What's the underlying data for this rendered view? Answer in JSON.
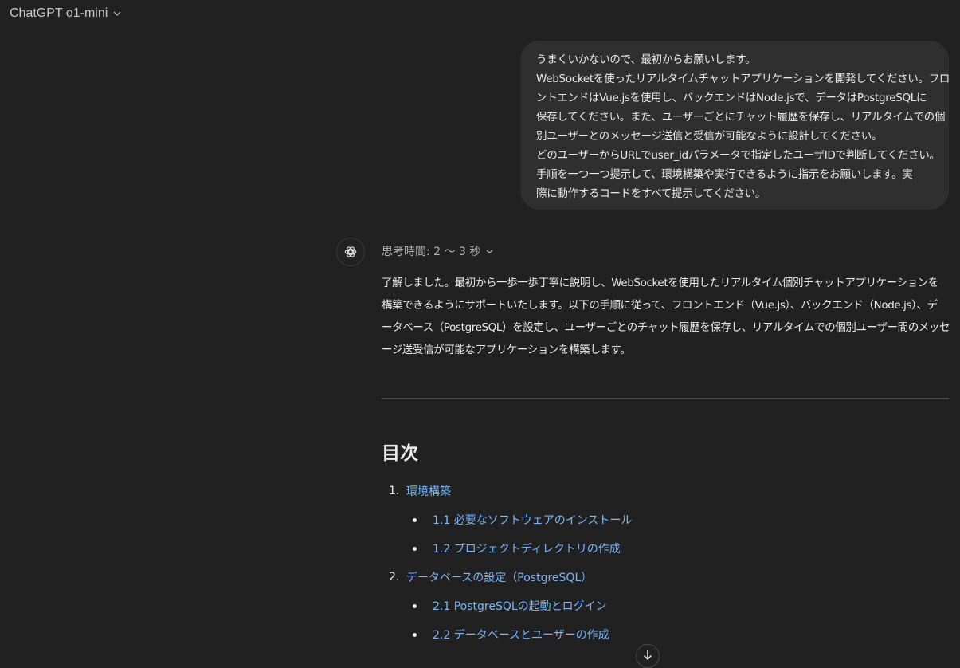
{
  "header": {
    "model_name": "ChatGPT o1-mini"
  },
  "user_message": {
    "lines": [
      "うまくいかないので、最初からお願いします。",
      "WebSocketを使ったリアルタイムチャットアプリケーションを開発してください。フロ",
      "ントエンドはVue.jsを使用し、バックエンドはNode.jsで、データはPostgreSQLに",
      "保存してください。また、ユーザーごとにチャット履歴を保存し、リアルタイムでの個",
      "別ユーザーとのメッセージ送信と受信が可能なように設計してください。",
      "どのユーザーからURLでuser_idパラメータで指定したユーザIDで判断してください。",
      "手順を一つ一つ提示して、環境構築や実行できるように指示をお願いします。実",
      "際に動作するコードをすべて提示してください。"
    ]
  },
  "assistant": {
    "thinking_label": "思考時間: 2 〜 3 秒",
    "intro_lines": [
      "了解しました。最初から一歩一歩丁寧に説明し、WebSocketを使用したリアルタイム個別チャットアプリケーションを",
      "構築できるようにサポートいたします。以下の手順に従って、フロントエンド（Vue.js）、バックエンド（Node.js）、デ",
      "ータベース（PostgreSQL）を設定し、ユーザーごとのチャット履歴を保存し、リアルタイムでの個別ユーザー間のメッセ",
      "ージ送受信が可能なアプリケーションを構築します。"
    ],
    "toc_title": "目次",
    "toc": [
      {
        "num": "1.",
        "label": "環境構築",
        "subs": [
          "1.1 必要なソフトウェアのインストール",
          "1.2 プロジェクトディレクトリの作成"
        ]
      },
      {
        "num": "2.",
        "label": "データベースの設定（PostgreSQL）",
        "subs": [
          "2.1 PostgreSQLの起動とログイン",
          "2.2 データベースとユーザーの作成"
        ]
      }
    ]
  },
  "colors": {
    "background": "#212121",
    "bubble": "#2f2f2f",
    "link": "#7ab7ff"
  }
}
